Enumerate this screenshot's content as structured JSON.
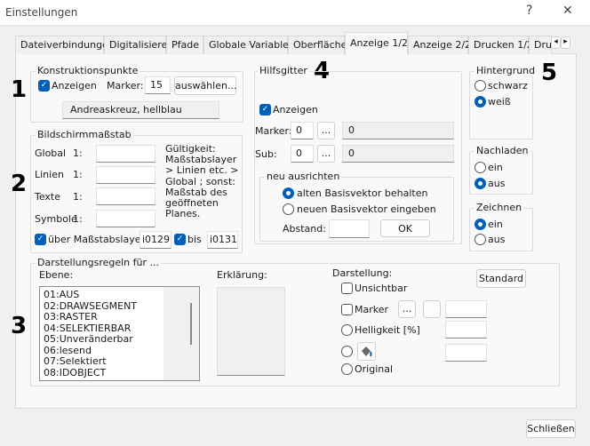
{
  "window": {
    "title": "Einstellungen",
    "help": "?",
    "close": "✕"
  },
  "tabs": [
    "Dateiverbindungen",
    "Digitalisierer",
    "Pfade",
    "Globale Variablen",
    "Oberfläche",
    "Anzeige 1/2",
    "Anzeige 2/2",
    "Drucken 1/2",
    "Dru"
  ],
  "tab_scroll": {
    "left": "◂",
    "right": "▸"
  },
  "active_tab": "Anzeige 1/2",
  "annotations": [
    "1",
    "2",
    "3",
    "4",
    "5"
  ],
  "konstruktionspunkte": {
    "title": "Konstruktionspunkte",
    "anzeigen": "Anzeigen",
    "anzeigen_checked": true,
    "marker_label": "Marker:",
    "marker_value": "15",
    "select_button": "auswählen...",
    "marker_name": "Andreaskreuz, hellblau"
  },
  "bildschirmmassstab": {
    "title": "Bildschirmmaßstab",
    "rows": [
      {
        "label": "Global",
        "prefix": "1:",
        "value": ""
      },
      {
        "label": "Linien",
        "prefix": "1:",
        "value": ""
      },
      {
        "label": "Texte",
        "prefix": "1:",
        "value": ""
      },
      {
        "label": "Symbole",
        "prefix": "1:",
        "value": ""
      }
    ],
    "note": "Gültigkeit: Maßstabslayer > Linien etc. > Global ; sonst: Maßstab des geöffneten Planes.",
    "ueber_label": "über Maßstabslayer:",
    "ueber_value": "i0129",
    "bis_label": "bis",
    "bis_value": "i0131"
  },
  "hilfsgitter": {
    "title": "Hilfsgitter",
    "anzeigen": "Anzeigen",
    "marker_label": "Marker:",
    "marker_value": "0",
    "marker_display": "0",
    "sub_label": "Sub:",
    "sub_value": "0",
    "sub_display": "0",
    "dots": "...",
    "neu_title": "neu ausrichten",
    "opt_alt": "alten Basisvektor behalten",
    "opt_neu": "neuen Basisvektor eingeben",
    "abstand_label": "Abstand:",
    "abstand_value": "",
    "ok": "OK"
  },
  "hintergrund": {
    "title": "Hintergrund",
    "options": [
      "schwarz",
      "weiß"
    ],
    "selected": "weiß"
  },
  "nachladen": {
    "title": "Nachladen",
    "options": [
      "ein",
      "aus"
    ],
    "selected": "aus"
  },
  "zeichnen": {
    "title": "Zeichnen",
    "options": [
      "ein",
      "aus"
    ],
    "selected": "ein"
  },
  "darstellungsregeln": {
    "title": "Darstellungsregeln für ...",
    "ebene_label": "Ebene:",
    "ebenen": [
      "01:AUS",
      "02:DRAWSEGMENT",
      "03:RASTER",
      "04:SELEKTIERBAR",
      "05:Unveränderbar",
      "06:lesend",
      "07:Selektiert",
      "08:IDOBJECT"
    ],
    "erklaerung_label": "Erklärung:",
    "darstellung_label": "Darstellung:",
    "standard": "Standard",
    "unsichtbar": "Unsichtbar",
    "marker": "Marker",
    "dots": "...",
    "helligkeit": "Helligkeit [%]",
    "original": "Original"
  },
  "footer": {
    "close": "Schließen"
  },
  "colors": {
    "accent": "#005fb8"
  }
}
